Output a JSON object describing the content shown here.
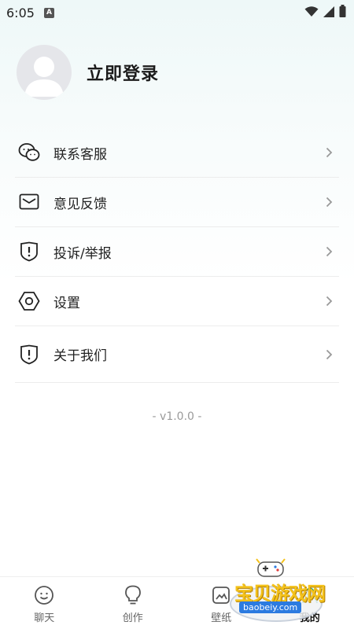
{
  "status": {
    "time": "6:05",
    "app_badge": "A"
  },
  "profile": {
    "login_label": "立即登录"
  },
  "menu": {
    "items": [
      {
        "label": "联系客服",
        "icon": "wechat-icon"
      },
      {
        "label": "意见反馈",
        "icon": "mail-icon"
      },
      {
        "label": "投诉/举报",
        "icon": "shield-alert-icon"
      },
      {
        "label": "设置",
        "icon": "hexagon-settings-icon"
      },
      {
        "label": "关于我们",
        "icon": "shield-info-icon"
      }
    ]
  },
  "version": "- v1.0.0 -",
  "tabbar": {
    "tabs": [
      {
        "label": "聊天",
        "icon": "chat-smile-icon",
        "active": false
      },
      {
        "label": "创作",
        "icon": "lightbulb-icon",
        "active": false
      },
      {
        "label": "壁纸",
        "icon": "wallpaper-icon",
        "active": false
      },
      {
        "label": "我的",
        "icon": "profile-icon",
        "active": true
      }
    ]
  },
  "watermark": {
    "text": "宝贝游戏网",
    "url": "baobeiy.com"
  }
}
